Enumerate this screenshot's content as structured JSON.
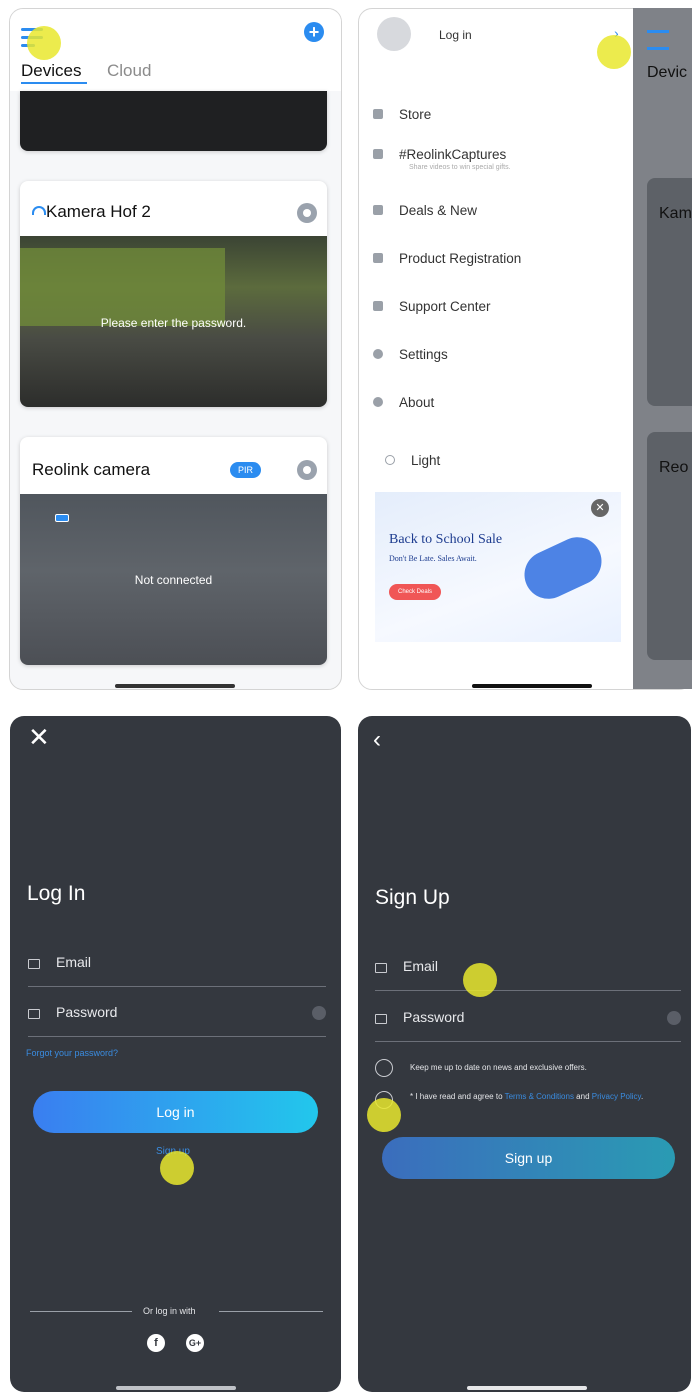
{
  "screen1": {
    "tabs": [
      "Devices",
      "Cloud"
    ],
    "cameras": [
      {
        "name": "Kamera Hof 2",
        "overlay": "Please enter the password."
      },
      {
        "name": "Reolink camera",
        "badge": "PIR",
        "overlay": "Not connected"
      }
    ],
    "colors": {
      "accent": "#2b8cf0"
    }
  },
  "screen2": {
    "login_label": "Log in",
    "menu": [
      {
        "icon": "store-icon",
        "label": "Store"
      },
      {
        "icon": "video-icon",
        "label": "#ReolinkCaptures",
        "sub": "Share videos to win special gifts."
      },
      {
        "icon": "flag-icon",
        "label": "Deals & New"
      },
      {
        "icon": "registration-icon",
        "label": "Product Registration"
      },
      {
        "icon": "support-icon",
        "label": "Support Center"
      },
      {
        "icon": "gear-icon",
        "label": "Settings"
      },
      {
        "icon": "info-icon",
        "label": "About"
      },
      {
        "icon": "sun-icon",
        "label": "Light"
      }
    ],
    "banner": {
      "title": "Back to School Sale",
      "subtitle": "Don't Be Late. Sales Await.",
      "cta": "Check Deals"
    },
    "peek": {
      "tab": "Devic",
      "card1": "Kam",
      "card2": "Reo"
    }
  },
  "screen3": {
    "title": "Log In",
    "email_label": "Email",
    "password_label": "Password",
    "forgot": "Forgot your password?",
    "login_button": "Log in",
    "signup_link": "Sign up",
    "or_login_with": "Or log in with"
  },
  "screen4": {
    "title": "Sign Up",
    "email_label": "Email",
    "password_label": "Password",
    "newsletter": "Keep me up to date on news and exclusive offers.",
    "terms_prefix": "* I have read and agree to ",
    "terms_link": "Terms & Conditions",
    "terms_and": " and ",
    "privacy_link": "Privacy Policy",
    "terms_end": ".",
    "signup_button": "Sign up"
  }
}
